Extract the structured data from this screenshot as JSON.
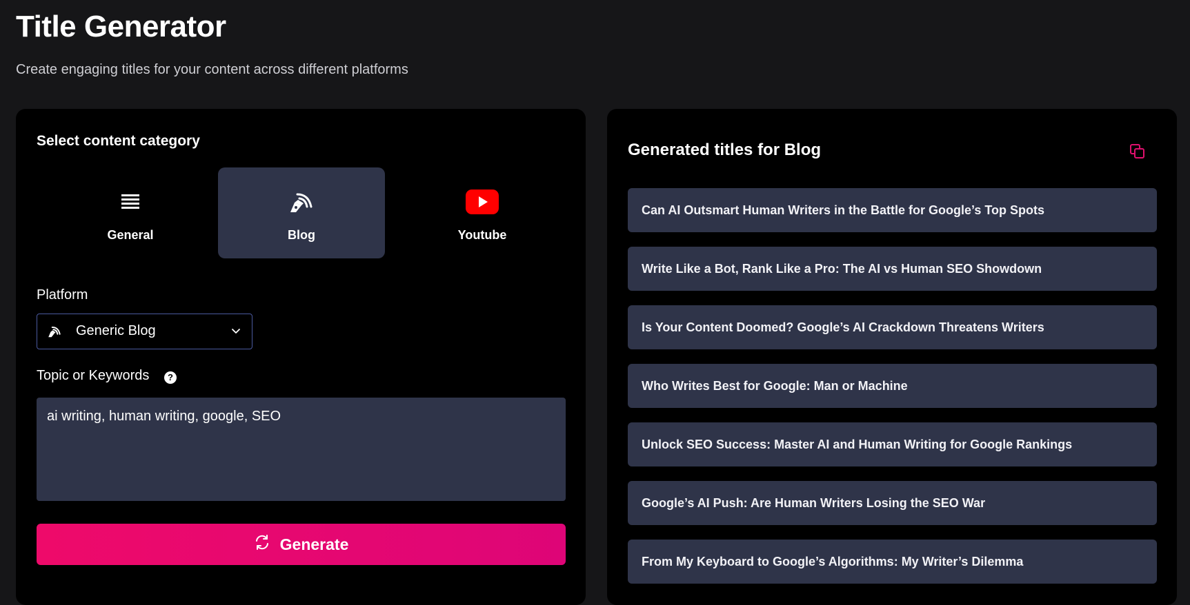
{
  "page": {
    "title": "Title Generator",
    "subtitle": "Create engaging titles for your content across different platforms"
  },
  "form": {
    "category_heading": "Select content category",
    "categories": [
      {
        "label": "General",
        "icon": "list-icon",
        "active": false
      },
      {
        "label": "Blog",
        "icon": "fountain-pen-rss-icon",
        "active": true
      },
      {
        "label": "Youtube",
        "icon": "youtube-icon",
        "active": false
      }
    ],
    "platform_label": "Platform",
    "platform_value": "Generic Blog",
    "topic_label": "Topic or Keywords",
    "topic_help": "?",
    "topic_value": "ai writing, human writing, google, SEO",
    "generate_label": "Generate"
  },
  "results": {
    "heading": "Generated titles for Blog",
    "titles": [
      "Can AI Outsmart Human Writers in the Battle for Google’s Top Spots",
      "Write Like a Bot, Rank Like a Pro: The AI vs Human SEO Showdown",
      "Is Your Content Doomed? Google’s AI Crackdown Threatens Writers",
      "Who Writes Best for Google: Man or Machine",
      "Unlock SEO Success: Master AI and Human Writing for Google Rankings",
      "Google’s AI Push: Are Human Writers Losing the SEO War",
      "From My Keyboard to Google’s Algorithms: My Writer’s Dilemma"
    ]
  },
  "colors": {
    "background": "#161618",
    "panel": "#000000",
    "card": "#2f3449",
    "accent": "#ee0a6a",
    "youtube_red": "#ff0000"
  }
}
